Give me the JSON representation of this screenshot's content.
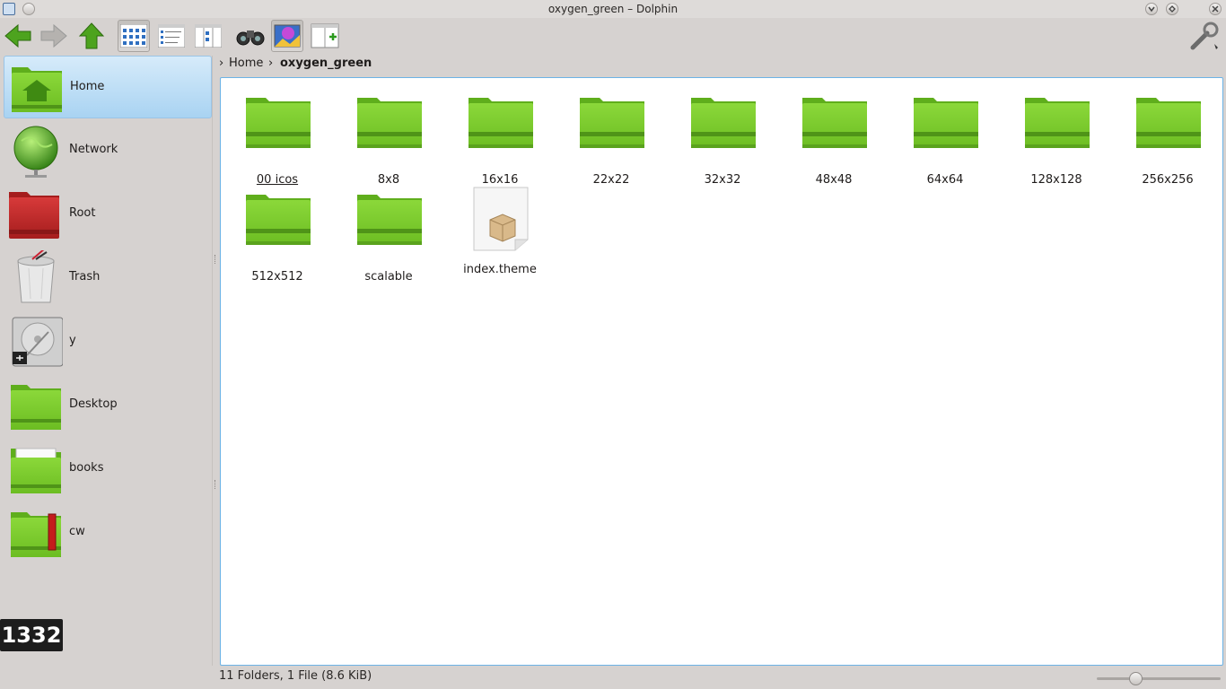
{
  "window": {
    "title": "oxygen_green – Dolphin"
  },
  "toolbar": {
    "items": [
      {
        "name": "back-button",
        "icon": "arrow-left-icon"
      },
      {
        "name": "forward-button",
        "icon": "arrow-right-icon"
      },
      {
        "name": "up-button",
        "icon": "arrow-up-icon"
      },
      {
        "name": "icons-view-button",
        "icon": "icons-view-icon"
      },
      {
        "name": "details-view-button",
        "icon": "details-view-icon"
      },
      {
        "name": "columns-view-button",
        "icon": "columns-view-icon"
      },
      {
        "name": "find-button",
        "icon": "binoculars-icon"
      },
      {
        "name": "preview-button",
        "icon": "preview-icon"
      },
      {
        "name": "split-button",
        "icon": "split-view-icon"
      },
      {
        "name": "settings-button",
        "icon": "wrench-icon"
      }
    ]
  },
  "sidebar": {
    "items": [
      {
        "label": "Home",
        "icon": "home-folder-icon"
      },
      {
        "label": "Network",
        "icon": "network-globe-icon"
      },
      {
        "label": "Root",
        "icon": "red-folder-icon"
      },
      {
        "label": "Trash",
        "icon": "trash-icon"
      },
      {
        "label": "y",
        "icon": "hard-drive-icon"
      },
      {
        "label": "Desktop",
        "icon": "desktop-folder-icon"
      },
      {
        "label": "books",
        "icon": "books-folder-icon"
      },
      {
        "label": "cw",
        "icon": "cw-folder-icon"
      }
    ]
  },
  "breadcrumb": {
    "items": [
      "Home",
      "oxygen_green"
    ]
  },
  "files": [
    {
      "label": "00 icos",
      "type": "folder"
    },
    {
      "label": "8x8",
      "type": "folder"
    },
    {
      "label": "16x16",
      "type": "folder"
    },
    {
      "label": "22x22",
      "type": "folder"
    },
    {
      "label": "32x32",
      "type": "folder"
    },
    {
      "label": "48x48",
      "type": "folder"
    },
    {
      "label": "64x64",
      "type": "folder"
    },
    {
      "label": "128x128",
      "type": "folder"
    },
    {
      "label": "256x256",
      "type": "folder"
    },
    {
      "label": "512x512",
      "type": "folder"
    },
    {
      "label": "scalable",
      "type": "folder"
    },
    {
      "label": "index.theme",
      "type": "file"
    }
  ],
  "status": {
    "text": "11 Folders, 1 File (8.6 KiB)",
    "zoom_fraction": 0.3
  },
  "osd": {
    "text": "1332"
  },
  "colors": {
    "folder_green": "#7ccc2c",
    "selection": "#a9d3f2",
    "view_border": "#6cb3e6"
  }
}
